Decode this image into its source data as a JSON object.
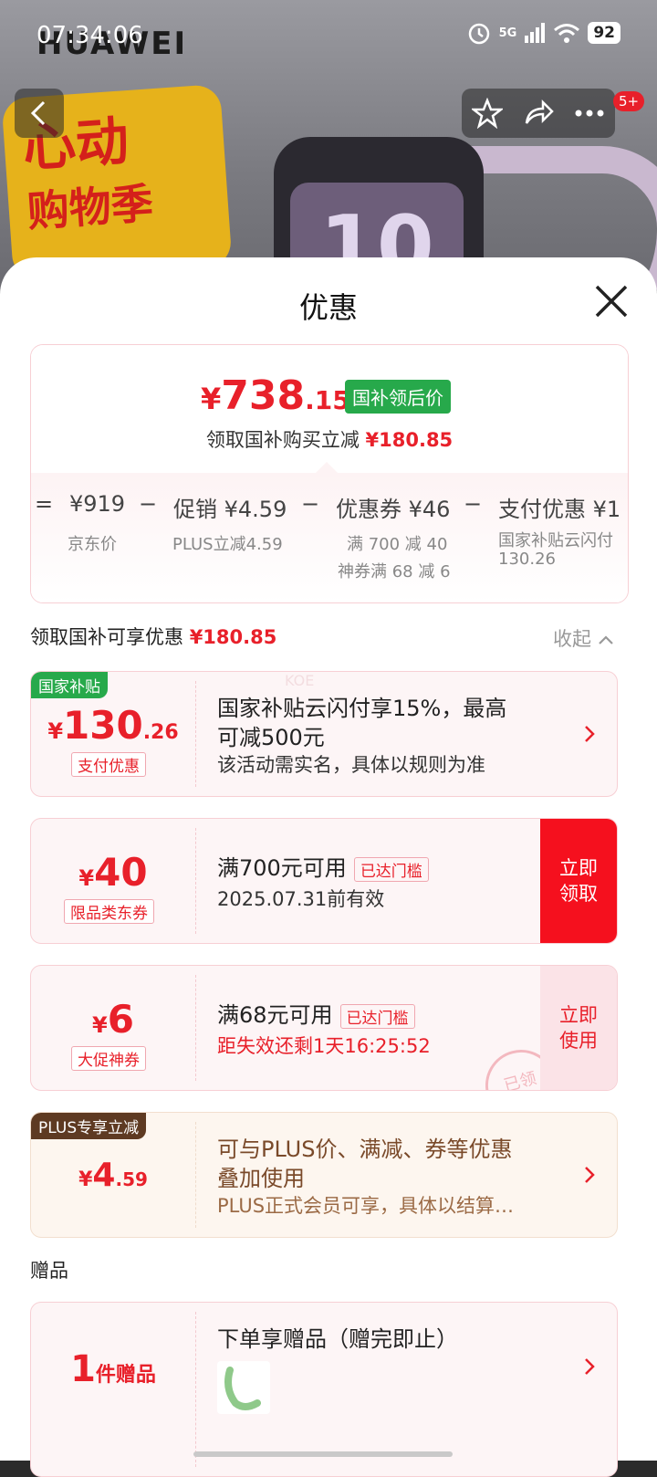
{
  "status_bar": {
    "time": "07:34:06",
    "network": "5G",
    "battery": "92"
  },
  "background": {
    "brand": "HUAWEI",
    "promo_line1": "心动",
    "promo_line2": "购物季",
    "watch_number": "10",
    "cart_badge": "5+"
  },
  "sheet": {
    "title": "优惠",
    "summary": {
      "price_symbol": "¥",
      "price_int": "738",
      "price_dec": ".15",
      "tag": "国补领后价",
      "line_prefix": "领取国补购买立减",
      "line_amount": "¥180.85",
      "breakdown": [
        {
          "op": "=",
          "label": "¥919",
          "sub1": "京东价",
          "sub2": ""
        },
        {
          "op": "−",
          "label": "促销 ¥4.59",
          "sub1": "PLUS立减4.59",
          "sub2": ""
        },
        {
          "op": "−",
          "label": "优惠券 ¥46",
          "sub1": "满 700 减 40",
          "sub2": "神券满 68 减 6"
        },
        {
          "op": "−",
          "label": "支付优惠 ¥1",
          "sub1": "国家补贴云闪付",
          "sub2": "130.26"
        }
      ]
    },
    "section_title": "领取国补可享优惠",
    "section_amount": "¥180.85",
    "collapse_label": "收起",
    "cards": [
      {
        "corner": "国家补贴",
        "symbol": "¥",
        "amount_int": "130",
        "amount_dec": ".26",
        "chip": "支付优惠",
        "main": "国家补贴云闪付享15%，最高",
        "main2": "可减500元",
        "sub": "该活动需实名，具体以规则为准",
        "watermark": "KOE"
      },
      {
        "symbol": "¥",
        "amount_int": "40",
        "chip": "限品类东券",
        "main": "满700元可用",
        "threshold": "已达门槛",
        "sub": "2025.07.31前有效",
        "action_line1": "立即",
        "action_line2": "领取"
      },
      {
        "symbol": "¥",
        "amount_int": "6",
        "chip": "大促神券",
        "main": "满68元可用",
        "threshold": "已达门槛",
        "sub": "距失效还剩1天16:25:52",
        "action_line1": "立即",
        "action_line2": "使用",
        "stamp": "已领"
      },
      {
        "corner": "PLUS专享立减",
        "symbol": "¥",
        "amount_int": "4",
        "amount_dec": ".59",
        "main": "可与PLUS价、满减、券等优惠",
        "main2": "叠加使用",
        "sub": "PLUS正式会员可享，具体以结算…"
      }
    ],
    "gift_title": "赠品",
    "gift": {
      "count": "1",
      "unit": "件赠品",
      "main": "下单享赠品（赠完即止）"
    }
  },
  "colors": {
    "accent": "#e8202a",
    "green": "#27a94b",
    "plus_brown": "#7a4a2a"
  }
}
